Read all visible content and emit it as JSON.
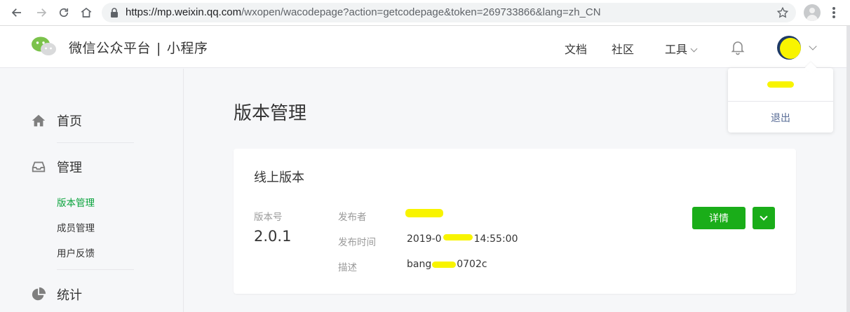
{
  "browser": {
    "url_host": "https://mp.weixin.qq.com",
    "url_path": "/wxopen/wacodepage?action=getcodepage&token=269733866&lang=zh_CN",
    "icons": [
      "back-arrow-icon",
      "forward-arrow-icon",
      "reload-icon",
      "home-icon",
      "lock-icon",
      "star-icon",
      "profile-icon",
      "kebab-menu-icon"
    ]
  },
  "header": {
    "brand": "微信公众平台",
    "separator": "|",
    "product": "小程序",
    "nav": {
      "docs": "文档",
      "community": "社区",
      "tools": "工具"
    }
  },
  "account_menu": {
    "logout": "退出"
  },
  "sidebar": {
    "home": "首页",
    "manage": "管理",
    "version_manage": "版本管理",
    "member_manage": "成员管理",
    "feedback": "用户反馈",
    "stats": "统计"
  },
  "main": {
    "title": "版本管理",
    "card": {
      "title": "线上版本",
      "version_label": "版本号",
      "version": "2.0.1",
      "publisher_label": "发布者",
      "publish_time_label": "发布时间",
      "publish_time_start": "2019-0",
      "publish_time_end": "14:55:00",
      "description_label": "描述",
      "description_start": "bang",
      "description_end": "0702c",
      "detail_button": "详情"
    }
  },
  "colors": {
    "primary_green": "#1aad19",
    "active_nav": "#07a23a",
    "link_blue": "#576b95",
    "redaction_yellow": "#f8f400"
  }
}
